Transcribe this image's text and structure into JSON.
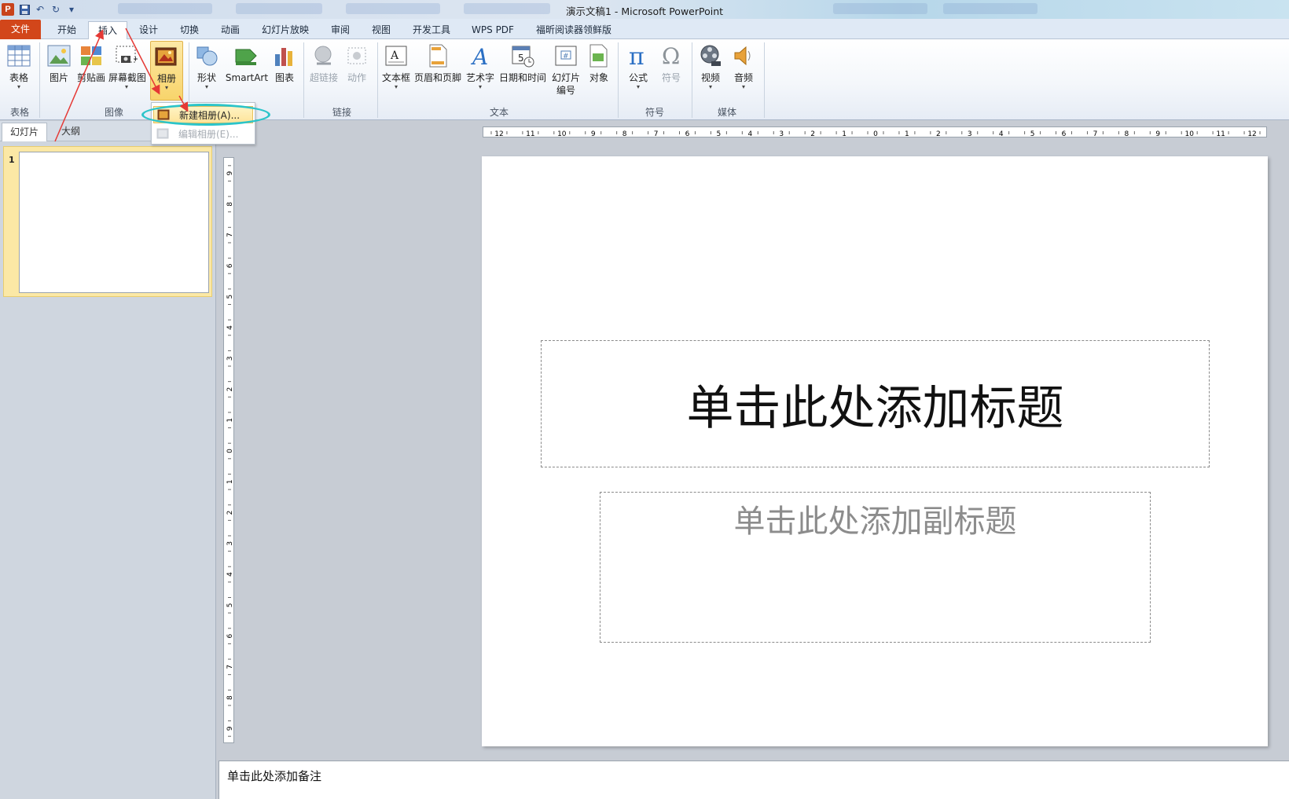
{
  "window": {
    "title": "演示文稿1 - Microsoft PowerPoint",
    "app_icon": "P"
  },
  "tabs": [
    "文件",
    "开始",
    "插入",
    "设计",
    "切换",
    "动画",
    "幻灯片放映",
    "审阅",
    "视图",
    "开发工具",
    "WPS PDF",
    "福昕阅读器领鲜版"
  ],
  "ribbon": {
    "table": "表格",
    "picture": "图片",
    "clipart": "剪贴画",
    "screenshot": "屏幕截图",
    "album": "相册",
    "shapes": "形状",
    "smartart": "SmartArt",
    "chart": "图表",
    "hyperlink": "超链接",
    "action": "动作",
    "textbox": "文本框",
    "header_footer": "页眉和页脚",
    "wordart": "艺术字",
    "datetime": "日期和时间",
    "slide_number_1": "幻灯片",
    "slide_number_2": "编号",
    "object": "对象",
    "equation": "公式",
    "symbol": "符号",
    "video": "视频",
    "audio": "音频",
    "groups": {
      "tables": "表格",
      "images": "图像",
      "links": "链接",
      "text": "文本",
      "symbols": "符号",
      "media": "媒体"
    }
  },
  "dropdown": {
    "new_album": "新建相册(A)...",
    "edit_album": "编辑相册(E)..."
  },
  "left_pane": {
    "tab_slides": "幻灯片",
    "tab_outline": "大纲",
    "slide_number": "1"
  },
  "slide": {
    "title_placeholder": "单击此处添加标题",
    "subtitle_placeholder": "单击此处添加副标题"
  },
  "notes": {
    "placeholder": "单击此处添加备注"
  },
  "rulers": {
    "horizontal": [
      "12",
      "11",
      "10",
      "9",
      "8",
      "7",
      "6",
      "5",
      "4",
      "3",
      "2",
      "1",
      "0",
      "1",
      "2",
      "3",
      "4",
      "5",
      "6",
      "7",
      "8",
      "9",
      "10",
      "11",
      "12"
    ],
    "vertical": [
      "9",
      "8",
      "7",
      "6",
      "5",
      "4",
      "3",
      "2",
      "1",
      "0",
      "1",
      "2",
      "3",
      "4",
      "5",
      "6",
      "7",
      "8",
      "9"
    ]
  },
  "colors": {
    "file_tab": "#d2461a",
    "highlight": "#f8d46b",
    "annotation_arrow": "#e53935",
    "annotation_ellipse": "#2bc4c9"
  }
}
